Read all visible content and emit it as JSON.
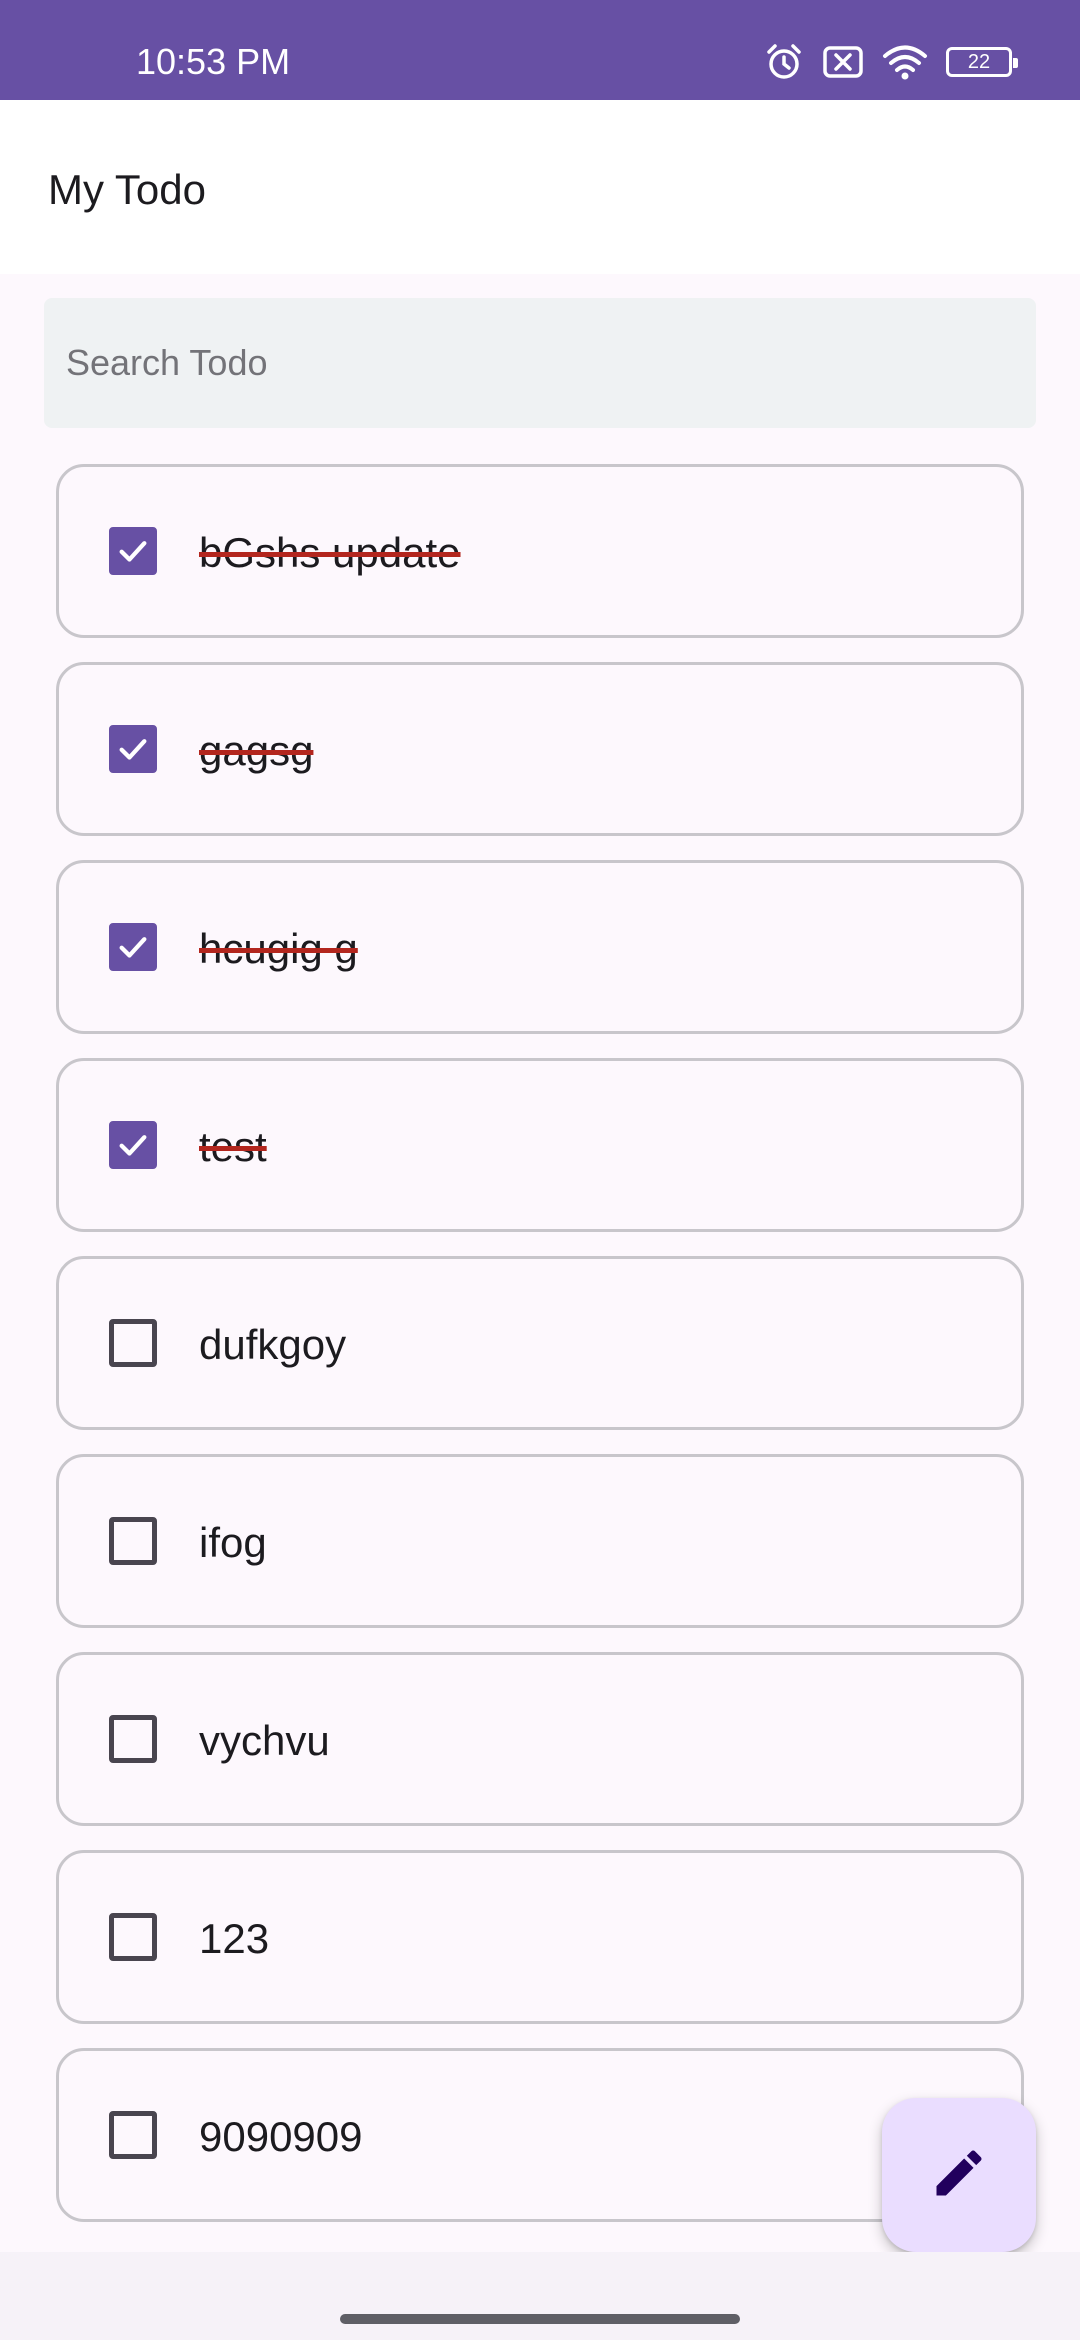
{
  "status_bar": {
    "time": "10:53 PM",
    "icons": [
      "alarm-icon",
      "no-sim-icon",
      "wifi-icon",
      "battery-icon"
    ],
    "battery_level": "22"
  },
  "app_bar": {
    "title": "My Todo"
  },
  "search": {
    "placeholder": "Search Todo",
    "value": ""
  },
  "todos": [
    {
      "text": "bGshs update",
      "done": true
    },
    {
      "text": "gagsg",
      "done": true
    },
    {
      "text": "hcugig g",
      "done": true
    },
    {
      "text": "test",
      "done": true
    },
    {
      "text": "dufkgoy",
      "done": false
    },
    {
      "text": "ifog",
      "done": false
    },
    {
      "text": "vychvu",
      "done": false
    },
    {
      "text": "123",
      "done": false
    },
    {
      "text": "9090909",
      "done": false
    }
  ],
  "fab": {
    "icon": "edit-pencil-icon"
  },
  "colors": {
    "primary": "#6750a4",
    "strikethrough": "#b3261e",
    "fab_background": "#eaddff",
    "search_background": "#eff2f3"
  }
}
